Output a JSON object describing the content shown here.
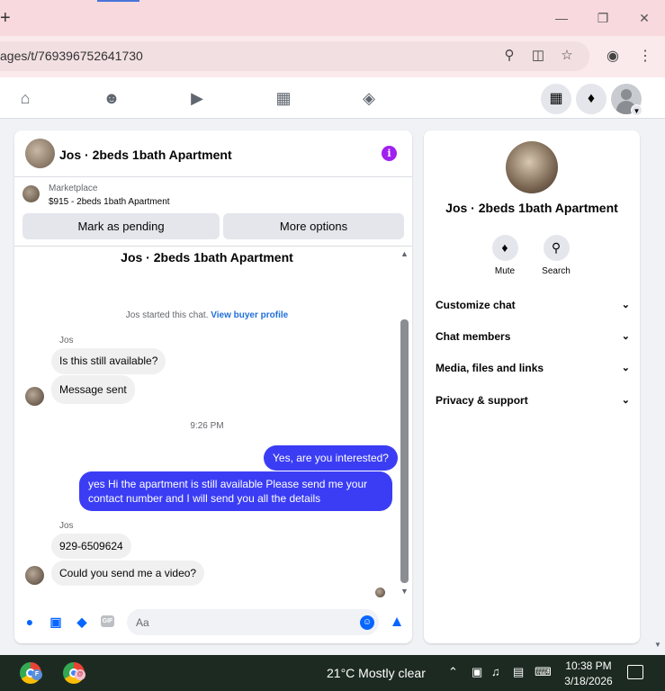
{
  "browser": {
    "url": "ages/t/769396752641730"
  },
  "chat": {
    "header_title": "Jos · 2beds 1bath Apartment",
    "listing": {
      "source": "Marketplace",
      "price_title": "$915 - 2beds 1bath Apartment",
      "mark_pending_label": "Mark as pending",
      "more_options_label": "More options"
    },
    "thread_title": "Jos · 2beds 1bath Apartment",
    "started_text": "Jos started this chat.",
    "view_buyer_label": "View buyer profile",
    "messages": [
      {
        "sender": "Jos",
        "text": "Is this still available?"
      },
      {
        "text": "Message sent"
      },
      {
        "timestamp": "9:26 PM"
      },
      {
        "text": "Yes, are you interested?"
      },
      {
        "text": "yes Hi the apartment is still available Please send me your contact number and I will send you all the details"
      },
      {
        "sender": "Jos",
        "text": "929-6509624"
      },
      {
        "text": "Could you send me a video?"
      }
    ],
    "composer": {
      "placeholder": "Aa",
      "gif_label": "GIF"
    }
  },
  "info_panel": {
    "name": "Jos · 2beds 1bath Apartment",
    "actions": [
      {
        "label": "Mute"
      },
      {
        "label": "Search"
      }
    ],
    "sections": [
      {
        "label": "Customize chat"
      },
      {
        "label": "Chat members"
      },
      {
        "label": "Media, files and links"
      },
      {
        "label": "Privacy & support"
      }
    ]
  },
  "taskbar": {
    "weather": "21°C  Mostly clear",
    "time": "10:38 PM",
    "date": "3/18/2026"
  },
  "colors": {
    "accent": "#0866ff",
    "outgoing_bubble": "#3b3df5",
    "info_icon": "#a020f0",
    "titlebar": "#f8d9de"
  }
}
